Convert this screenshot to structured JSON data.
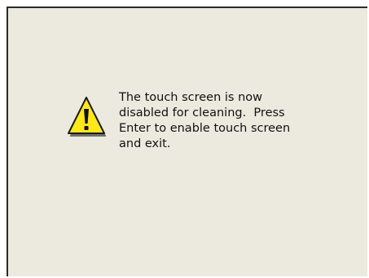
{
  "dialog": {
    "icon": "warning-icon",
    "message_lines": [
      "The touch screen is now",
      "disabled for cleaning.  Press",
      "Enter to enable touch screen",
      "and exit."
    ]
  },
  "colors": {
    "background": "#ece9df",
    "warning_fill": "#ffe81a",
    "text": "#111111"
  }
}
